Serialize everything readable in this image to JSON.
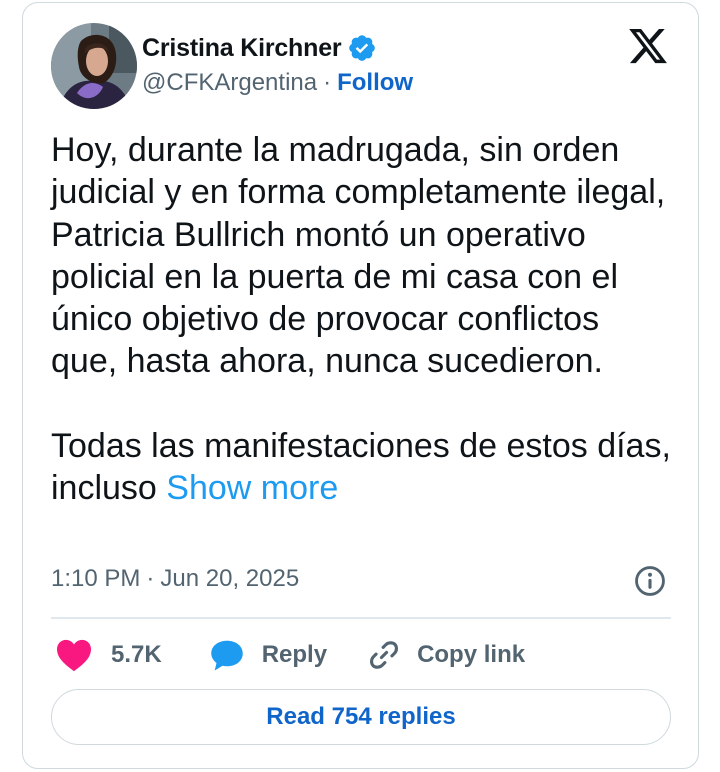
{
  "author": {
    "name": "Cristina Kirchner",
    "handle": "@CFKArgentina",
    "separator": "·",
    "follow_label": "Follow",
    "verified_icon": "verified-badge-icon",
    "verified_color": "#1d9bf0"
  },
  "tweet": {
    "body": "Hoy, durante la madrugada, sin orden judicial y en forma completamente ilegal, Patricia Bullrich montó un operativo policial en la puerta de mi casa con el único objetivo de provocar conflictos que, hasta ahora, nunca sucedieron.\n\nTodas las manifestaciones de estos días, incluso ",
    "show_more_label": "Show more",
    "time": "1:10 PM",
    "date_separator": "·",
    "date": "Jun 20, 2025"
  },
  "actions": {
    "like_count": "5.7K",
    "reply_label": "Reply",
    "copy_link_label": "Copy link",
    "read_replies_label": "Read 754 replies"
  },
  "colors": {
    "like": "#f91880",
    "reply": "#1d9bf0",
    "link": "#0f65c9",
    "text": "#0f1419",
    "muted": "#536471",
    "border": "#cfd9de"
  },
  "icons": {
    "brand": "x-logo-icon",
    "info": "info-icon",
    "like": "heart-icon",
    "reply": "speech-bubble-icon",
    "copy": "link-icon"
  }
}
